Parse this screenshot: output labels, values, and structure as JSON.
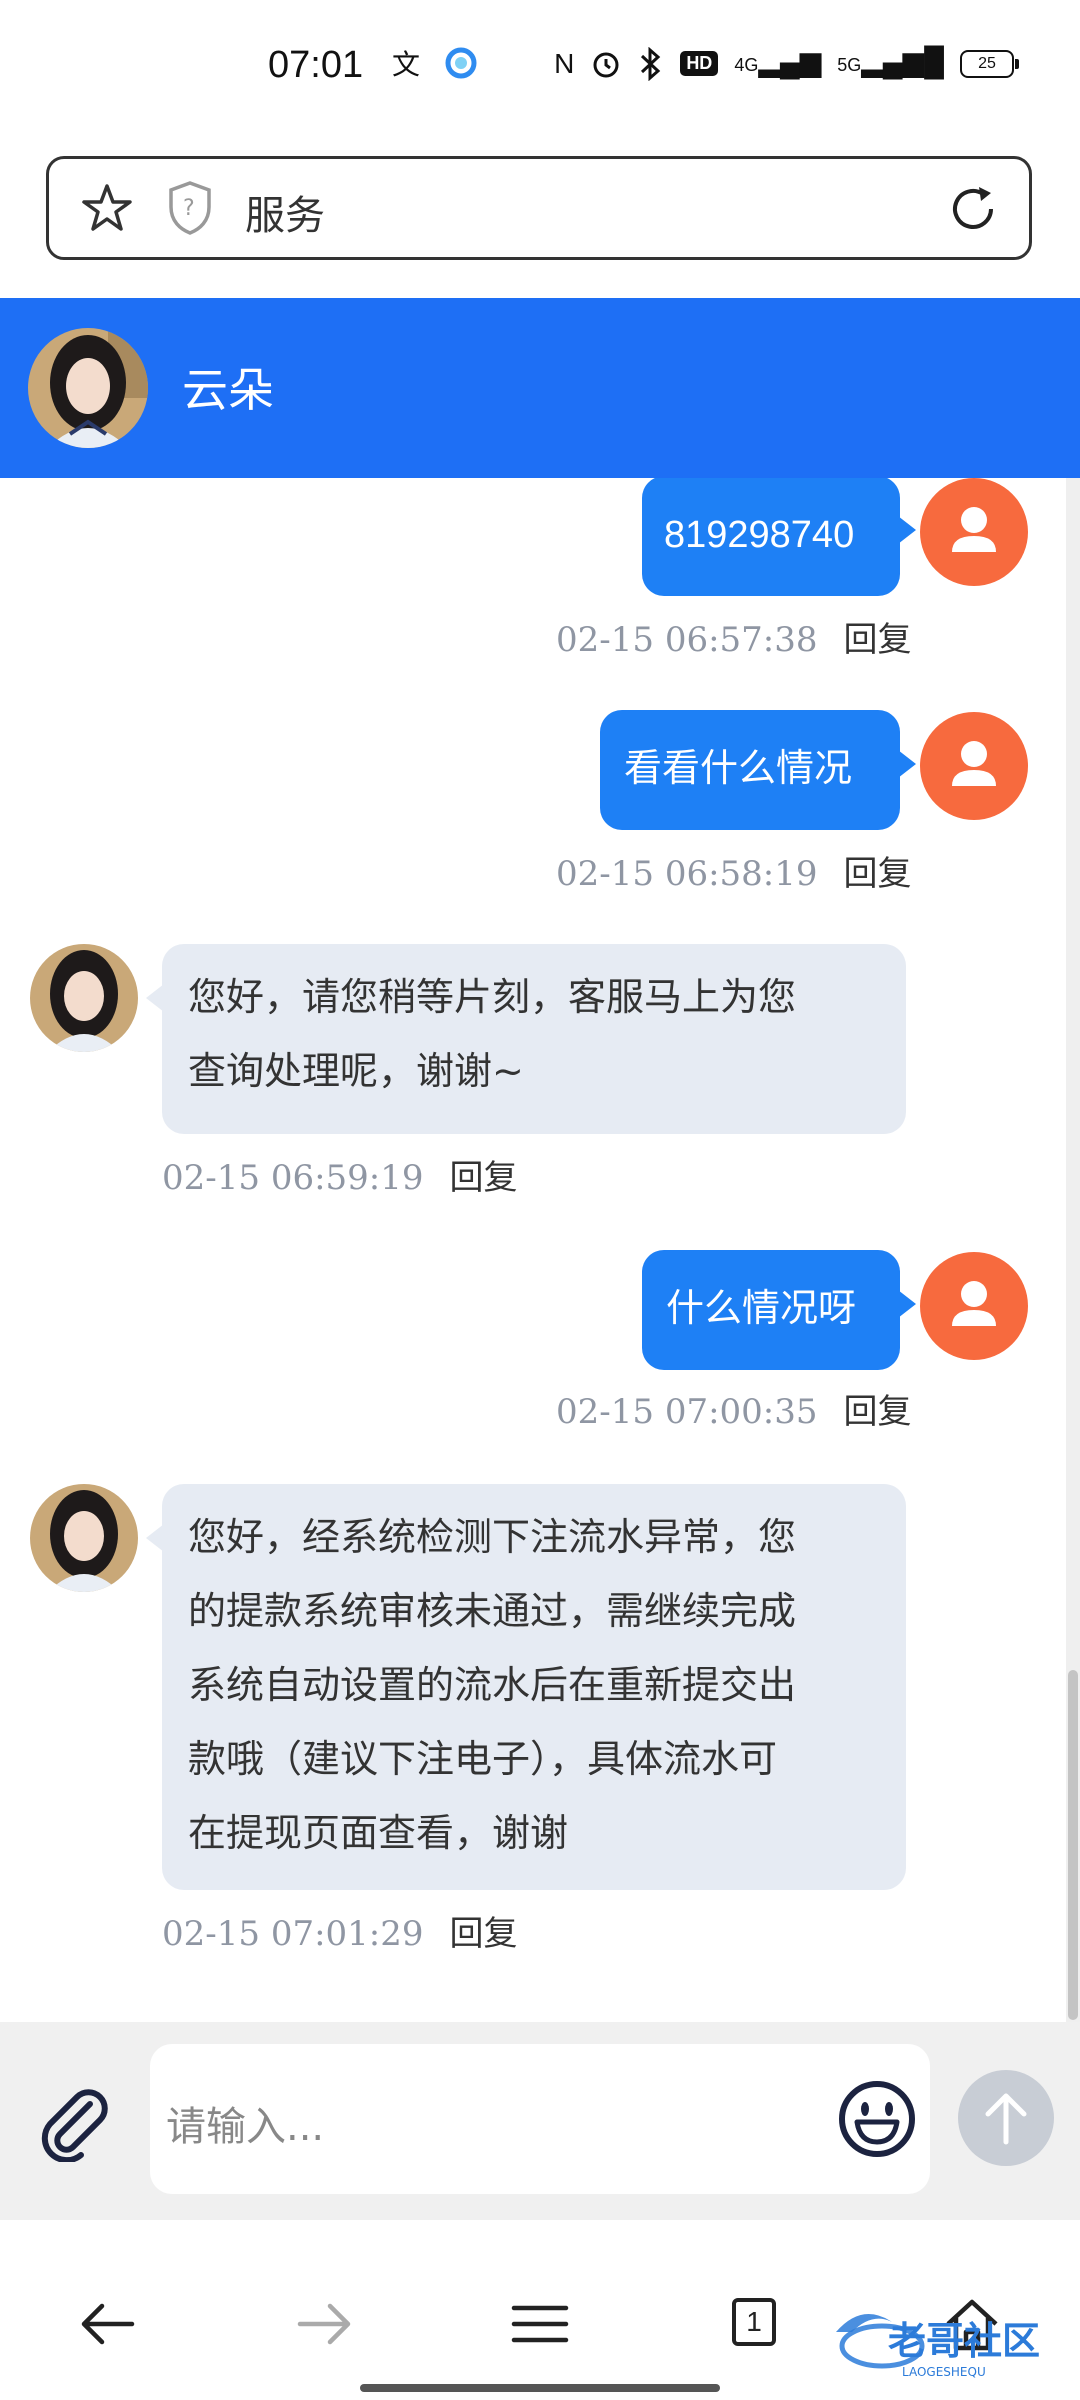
{
  "status_bar": {
    "time": "07:01",
    "network": "5G",
    "network2": "4G",
    "hd_label": "HD",
    "battery": "25"
  },
  "address_bar": {
    "title": "服务"
  },
  "chat": {
    "contact_name": "云朵",
    "messages": [
      {
        "side": "right",
        "text": "819298740",
        "time": "02-15 06:57:38",
        "reply": "回复"
      },
      {
        "side": "right",
        "text": "看看什么情况",
        "time": "02-15 06:58:19",
        "reply": "回复"
      },
      {
        "side": "left",
        "lines": [
          "您好，请您稍等片刻，客服马上为您",
          "查询处理呢，谢谢~"
        ],
        "time": "02-15 06:59:19",
        "reply": "回复"
      },
      {
        "side": "right",
        "text": "什么情况呀",
        "time": "02-15 07:00:35",
        "reply": "回复"
      },
      {
        "side": "left",
        "lines": [
          "您好，经系统检测下注流水异常，您",
          "的提款系统审核未通过，需继续完成",
          "系统自动设置的流水后在重新提交出",
          "款哦（建议下注电子），具体流水可",
          "在提现页面查看，谢谢"
        ],
        "time": "02-15 07:01:29",
        "reply": "回复"
      }
    ]
  },
  "input": {
    "placeholder": "请输入..."
  },
  "nav": {
    "tab_count": "1"
  },
  "watermark": {
    "text": "老哥社区",
    "subtext": "LAOGESHEQU"
  },
  "colors": {
    "header_blue": "#1e6ff5",
    "bubble_blue": "#1e80f5",
    "user_avatar_orange": "#f76a3e",
    "bubble_grey": "#e6ebf3"
  }
}
